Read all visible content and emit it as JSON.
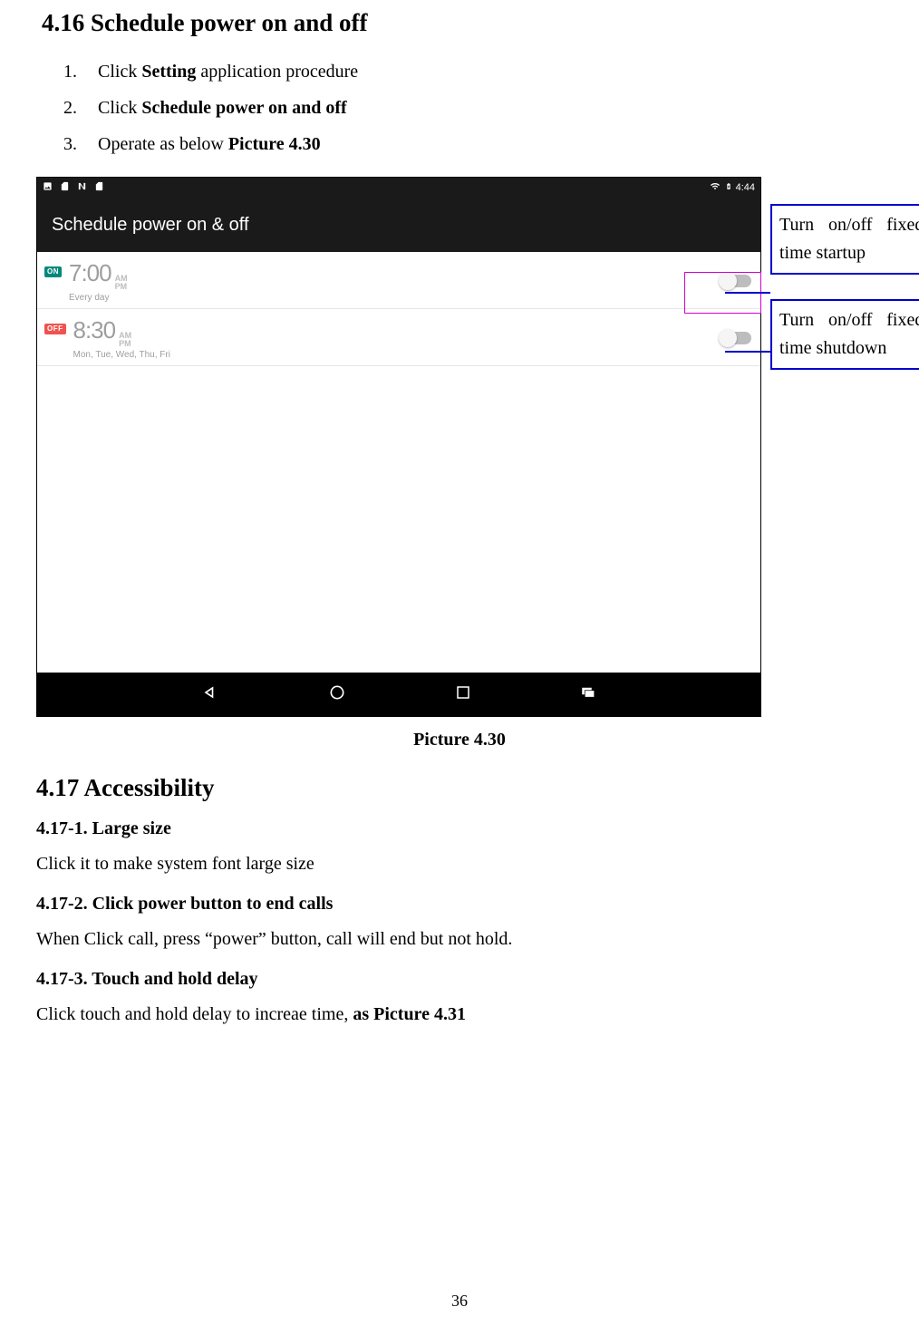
{
  "section1": {
    "heading": "4.16 Schedule power on and off",
    "steps": [
      {
        "n": "1.",
        "pre": "Click ",
        "bold": "Setting",
        "post": " application procedure"
      },
      {
        "n": "2.",
        "pre": "Click ",
        "bold": "Schedule power on and off",
        "post": ""
      },
      {
        "n": "3.",
        "pre": "Operate as below ",
        "bold": "Picture 4.30",
        "post": ""
      }
    ]
  },
  "device": {
    "statusbar": {
      "time": "4:44"
    },
    "appbar_title": "Schedule power on & off",
    "rows": [
      {
        "badge": "ON",
        "time": "7:00",
        "ampm_top": "AM",
        "ampm_bot": "PM",
        "days": "Every day"
      },
      {
        "badge": "OFF",
        "time": "8:30",
        "ampm_top": "AM",
        "ampm_bot": "PM",
        "days": "Mon, Tue, Wed, Thu, Fri"
      }
    ]
  },
  "callouts": {
    "c1": "Turn on/off fixed-time startup",
    "c2": "Turn on/off fixed-time shutdown"
  },
  "caption": "Picture 4.30",
  "section2": {
    "heading": "4.17 Accessibility",
    "items": [
      {
        "head": "4.17-1. Large size",
        "body_pre": "Click it to make system font large size",
        "body_bold": ""
      },
      {
        "head": "4.17-2. Click power button to end calls",
        "body_pre": "When Click call, press “power” button, call will end but not hold.",
        "body_bold": ""
      },
      {
        "head": "4.17-3. Touch and hold delay",
        "body_pre": "Click touch and hold delay to increae time, ",
        "body_bold": "as Picture 4.31"
      }
    ]
  },
  "page_number": "36"
}
